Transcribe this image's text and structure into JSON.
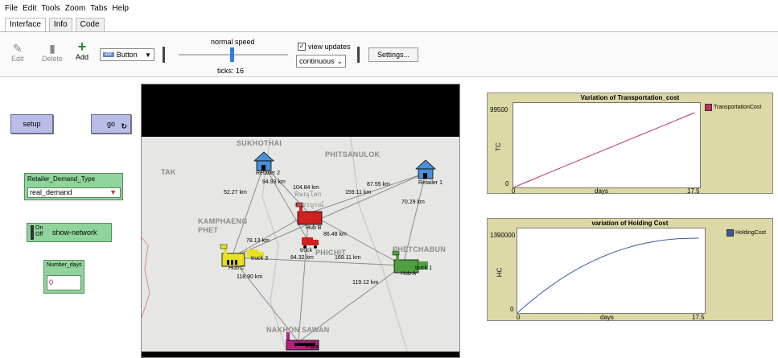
{
  "menu": [
    "File",
    "Edit",
    "Tools",
    "Zoom",
    "Tabs",
    "Help"
  ],
  "tabs": [
    "Interface",
    "Info",
    "Code"
  ],
  "toolbar": {
    "edit": "Edit",
    "delete": "Delete",
    "add": "Add",
    "widget_type": "Button",
    "widget_tag": "abc",
    "speed_label": "normal speed",
    "ticks_label": "ticks: 16",
    "view_updates_label": "view updates",
    "view_updates_checked": "✓",
    "update_mode": "continuous",
    "settings_label": "Settings..."
  },
  "widgets": {
    "setup_label": "setup",
    "go_label": "go",
    "go_glyph": "↻",
    "chooser_title": "Retailer_Demand_Type",
    "chooser_value": "real_demand",
    "switch_on": "On",
    "switch_off": "Off",
    "switch_label": "show-network",
    "input_title": "Number_days",
    "input_value": "0"
  },
  "map": {
    "regions": [
      "TAK",
      "PHITSANULOK",
      "KAMPHAENG PHET",
      "PHETCHABUN",
      "NAKHON SAWAN",
      "SUKHOTHAI",
      "PHICHIT"
    ],
    "distances": [
      "52.27 km",
      "94.93 km",
      "104.84 km",
      "159.11 km",
      "87.55 km",
      "70.29 km",
      "78.13 km",
      "86.48 km",
      "84.32 km",
      "169.11 km",
      "118.90 km",
      "119.12 km"
    ],
    "nodes": [
      "Retailer 2",
      "Retailer 1",
      "truck 3",
      "truck",
      "truck 1",
      "Plant",
      "Hub C",
      "Hub A",
      "Hub B"
    ],
    "thai_text": [
      "พิษณุโลก",
      "เพชรบูรณ์"
    ],
    "colors": {
      "retailer": "#4a90d9",
      "hub_b": "#d02020",
      "hub_c": "#e8e020",
      "hub_a": "#50a040",
      "plant": "#b02080"
    }
  },
  "plots": [
    {
      "title": "Variation of Transportation_cost",
      "ylabel": "TC",
      "xlabel": "days",
      "ymax_label": "99500",
      "ymin_label": "0",
      "xmin_label": "0",
      "xmax_label": "17.5",
      "legend": "TransportationCost",
      "color": "#c0306a"
    },
    {
      "title": "variation of Holding Cost",
      "ylabel": "HC",
      "xlabel": "days",
      "ymax_label": "1390000",
      "ymin_label": "0",
      "xmin_label": "0",
      "xmax_label": "17.5",
      "legend": "HoldingCost",
      "color": "#3a5a9a"
    }
  ]
}
